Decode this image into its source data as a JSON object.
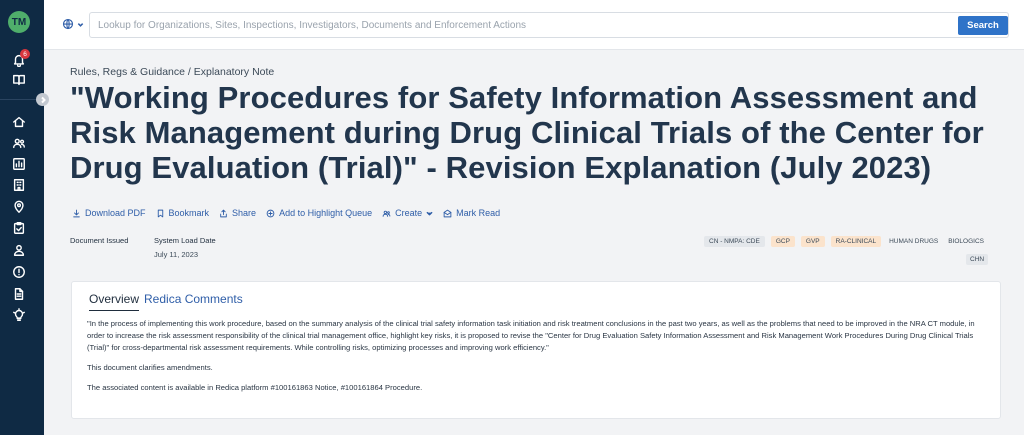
{
  "user": {
    "initials": "TM"
  },
  "notifications": {
    "count": "6"
  },
  "search": {
    "placeholder": "Lookup for Organizations, Sites, Inspections, Investigators, Documents and Enforcement Actions",
    "button_label": "Search"
  },
  "breadcrumb": "Rules, Regs & Guidance / Explanatory Note",
  "title": "\"Working Procedures for Safety Information Assessment and Risk Management during Drug Clinical Trials of the Center for Drug Evaluation (Trial)\" - Revision Explanation (July 2023)",
  "actions": {
    "download": "Download PDF",
    "bookmark": "Bookmark",
    "share": "Share",
    "highlight": "Add to Highlight Queue",
    "create": "Create",
    "mark_read": "Mark Read"
  },
  "meta": {
    "issued_label": "Document Issued",
    "load_label": "System Load Date",
    "load_value": "July 11, 2023"
  },
  "tags": [
    "CN - NMPA: CDE",
    "GCP",
    "GVP",
    "RA-CLINICAL",
    "HUMAN DRUGS",
    "BIOLOGICS",
    "CHN"
  ],
  "tabs": {
    "overview": "Overview",
    "comments": "Redica Comments"
  },
  "content": {
    "p1": "\"In the process of implementing this work procedure, based on the summary analysis of the clinical trial safety information task initiation and risk treatment conclusions in the past two years, as well as the problems that need to be improved in the NRA CT module, in order to increase the risk assessment responsibility of the clinical trial management office, highlight key risks, it is proposed to revise the \"Center for Drug Evaluation Safety Information Assessment and Risk Management Work Procedures During Drug Clinical Trials (Trial)\" for cross-departmental risk assessment requirements. While controlling risks, optimizing processes and improving work efficiency.\"",
    "p2": "This document clarifies amendments.",
    "p3": "The associated content is available in Redica platform #100161863 Notice, #100161864 Procedure."
  },
  "colors": {
    "sidebar": "#0f2a44",
    "accent": "#2f73c8",
    "link": "#2f5ea8",
    "avatar": "#4fae6b",
    "badge": "#d9363e"
  },
  "icons": [
    "globe-icon",
    "bell-icon",
    "book-icon",
    "home-icon",
    "users-icon",
    "chart-icon",
    "building-icon",
    "map-pin-icon",
    "clipboard-check-icon",
    "user-icon",
    "alert-circle-icon",
    "document-icon",
    "lightbulb-icon",
    "download-icon",
    "bookmark-icon",
    "share-icon",
    "plus-circle-icon",
    "users-icon",
    "envelope-icon"
  ]
}
